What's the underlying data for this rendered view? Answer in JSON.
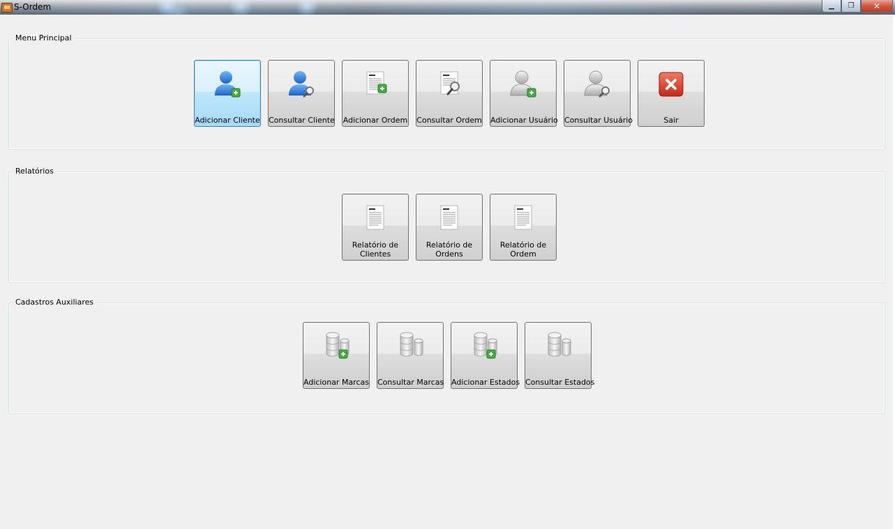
{
  "window": {
    "title": "S-Ordem",
    "minimize": "▁",
    "maximize": "❐",
    "close": "✕"
  },
  "groups": [
    {
      "label": "Menu Principal",
      "buttons": [
        {
          "label": "Adicionar Cliente",
          "icon": "user-add-icon",
          "focused": true
        },
        {
          "label": "Consultar Cliente",
          "icon": "user-search-icon"
        },
        {
          "label": "Adicionar Ordem",
          "icon": "document-add-icon"
        },
        {
          "label": "Consultar Ordem",
          "icon": "document-search-icon"
        },
        {
          "label": "Adicionar Usuário",
          "icon": "gray-user-add-icon"
        },
        {
          "label": "Consultar Usuário",
          "icon": "gray-user-search-icon"
        },
        {
          "label": "Sair",
          "icon": "exit-icon"
        }
      ]
    },
    {
      "label": "Relatórios",
      "buttons": [
        {
          "label": "Relatório de Clientes",
          "icon": "report-icon"
        },
        {
          "label": "Relatório de Ordens",
          "icon": "report-icon"
        },
        {
          "label": "Relatório de Ordem",
          "icon": "report-icon"
        }
      ]
    },
    {
      "label": "Cadastros Auxiliares",
      "buttons": [
        {
          "label": "Adicionar Marcas",
          "icon": "database-add-icon"
        },
        {
          "label": "Consultar Marcas",
          "icon": "database-icon"
        },
        {
          "label": "Adicionar Estados",
          "icon": "database-add-icon"
        },
        {
          "label": "Consultar Estados",
          "icon": "database-icon"
        }
      ]
    }
  ]
}
